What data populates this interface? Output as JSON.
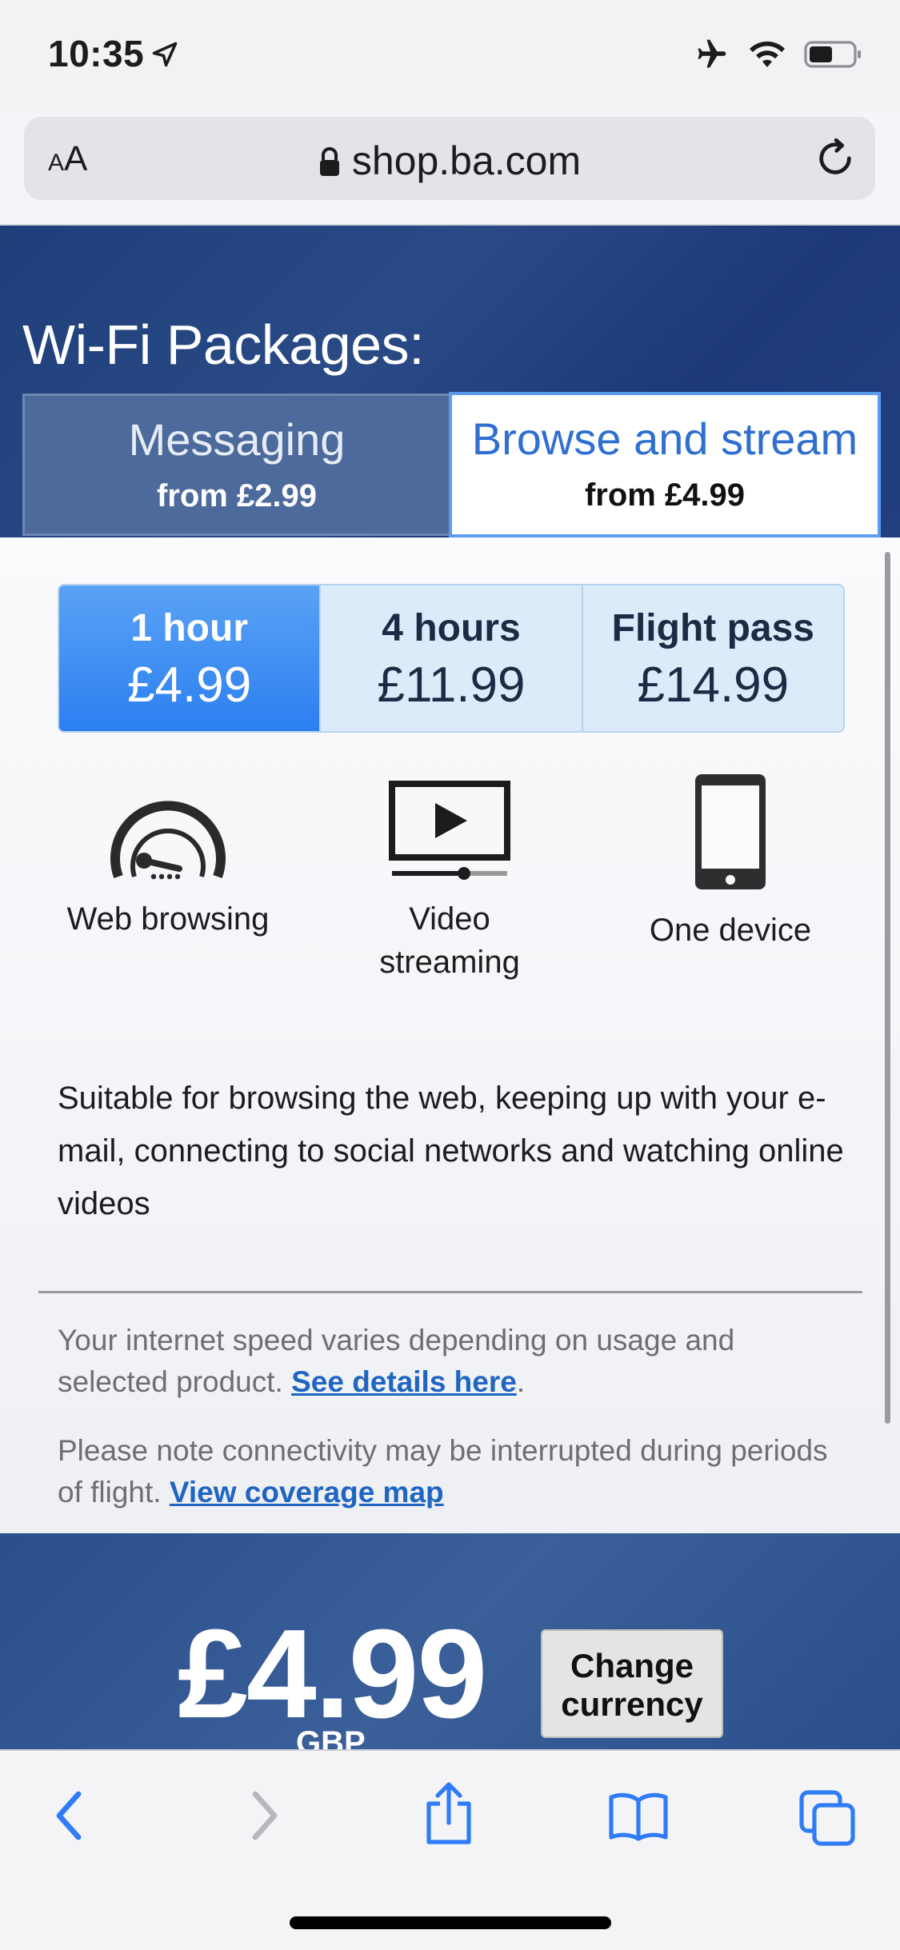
{
  "status": {
    "time": "10:35"
  },
  "browser": {
    "text_size_label_small": "A",
    "text_size_label_large": "A",
    "url": "shop.ba.com"
  },
  "header": {
    "title": "Wi-Fi Packages:"
  },
  "tabs": [
    {
      "name": "Messaging",
      "from": "from £2.99",
      "selected": false
    },
    {
      "name": "Browse and stream",
      "from": "from £4.99",
      "selected": true
    }
  ],
  "plans": [
    {
      "name": "1 hour",
      "price": "£4.99",
      "selected": true
    },
    {
      "name": "4 hours",
      "price": "£11.99",
      "selected": false
    },
    {
      "name": "Flight pass",
      "price": "£14.99",
      "selected": false
    }
  ],
  "features": [
    {
      "icon": "speedometer-icon",
      "label": "Web browsing"
    },
    {
      "icon": "video-player-icon",
      "label_line1": "Video",
      "label_line2": "streaming"
    },
    {
      "icon": "smartphone-icon",
      "label": "One device"
    }
  ],
  "description": "Suitable for browsing the web, keeping up with your e-mail, connecting to social networks and watching online videos",
  "notes": {
    "speed_text": "Your internet speed varies depending on usage and selected product.",
    "speed_link": "See details here",
    "speed_end": ".",
    "coverage_text": "Please note connectivity may be interrupted during periods of flight.",
    "coverage_link": "View coverage map"
  },
  "price": {
    "amount": "£4.99",
    "currency": "GBP",
    "change_line1": "Change",
    "change_line2": "currency"
  },
  "colors": {
    "brand_blue": "#1f3f7a",
    "accent_blue": "#2b7ff0",
    "link_blue": "#1f65c2"
  }
}
